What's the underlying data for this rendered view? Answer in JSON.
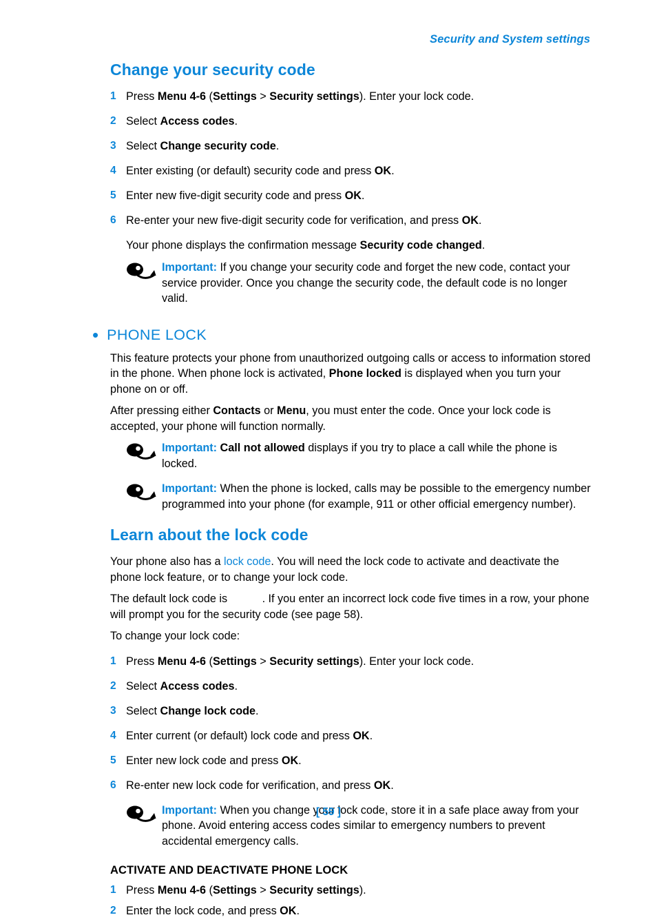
{
  "header": {
    "running_head": "Security and System settings"
  },
  "footer": {
    "page_number": "[ 59 ]"
  },
  "sections": {
    "change_security_code": {
      "title": "Change your security code",
      "steps": [
        {
          "num": "1",
          "html": "Press <b>Menu 4-6</b> (<b>Settings</b> &gt; <b>Security settings</b>). Enter your lock code."
        },
        {
          "num": "2",
          "html": "Select <b>Access codes</b>."
        },
        {
          "num": "3",
          "html": "Select <b>Change security code</b>."
        },
        {
          "num": "4",
          "html": "Enter existing (or default) security code and press <b>OK</b>."
        },
        {
          "num": "5",
          "html": "Enter new five-digit security code and press <b>OK</b>."
        },
        {
          "num": "6",
          "html": "Re-enter your new five-digit security code for verification, and press <b>OK</b>."
        }
      ],
      "confirmation_note": "Your phone displays the confirmation message <b>Security code changed</b>.",
      "important": {
        "label": "Important:",
        "html": "If you change your security code and forget the new code, contact your service provider. Once you change the security code, the default code is no longer valid."
      }
    },
    "phone_lock": {
      "bullet": "•",
      "title": "PHONE LOCK",
      "paragraphs": [
        "This feature protects your phone from unauthorized outgoing calls or access to information stored in the phone. When phone lock is activated, <b>Phone locked</b> is displayed when you turn your phone on or off.",
        "After pressing either <b>Contacts</b> or <b>Menu</b>, you must enter the code. Once your lock code is accepted, your phone will function normally."
      ],
      "importants": [
        {
          "label": "Important:",
          "html": "<b>Call not allowed</b> displays if you try to place a call while the phone is locked."
        },
        {
          "label": "Important:",
          "html": "When the phone is locked, calls may be possible to the emergency number programmed into your phone (for example, 911 or other official emergency number)."
        }
      ]
    },
    "learn_lock_code": {
      "title": "Learn about the lock code",
      "paragraphs": [
        "Your phone also has a <span class=\"linkword\">lock code</span>. You will need the lock code to activate and deactivate the phone lock feature, or to change your lock code.",
        "The default lock code is <span class=\"blank-inline\"></span>. If you enter an incorrect lock code five times in a row, your phone will prompt you for the security code (see page 58).",
        "To change your lock code:"
      ],
      "steps": [
        {
          "num": "1",
          "html": "Press <b>Menu 4-6</b> (<b>Settings</b> &gt; <b>Security settings</b>). Enter your lock code."
        },
        {
          "num": "2",
          "html": "Select <b>Access codes</b>."
        },
        {
          "num": "3",
          "html": "Select <b>Change lock code</b>."
        },
        {
          "num": "4",
          "html": "Enter current (or default) lock code and press <b>OK</b>."
        },
        {
          "num": "5",
          "html": "Enter new lock code and press <b>OK</b>."
        },
        {
          "num": "6",
          "html": "Re-enter new lock code for verification, and press <b>OK</b>."
        }
      ],
      "important": {
        "label": "Important:",
        "html": "When you change your lock code, store it in a safe place away from your phone. Avoid entering access codes similar to emergency numbers to prevent accidental emergency calls."
      }
    },
    "activate_deactivate": {
      "title": "ACTIVATE AND DEACTIVATE PHONE LOCK",
      "steps": [
        {
          "num": "1",
          "html": "Press <b>Menu 4-6</b> (<b>Settings</b> &gt; <b>Security settings</b>)."
        },
        {
          "num": "2",
          "html": "Enter the lock code, and press <b>OK</b>."
        }
      ]
    }
  },
  "colors": {
    "accent": "#0c86d8",
    "text": "#000000",
    "background": "#ffffff"
  },
  "icons": {
    "important_note": "note-pointer-icon"
  }
}
